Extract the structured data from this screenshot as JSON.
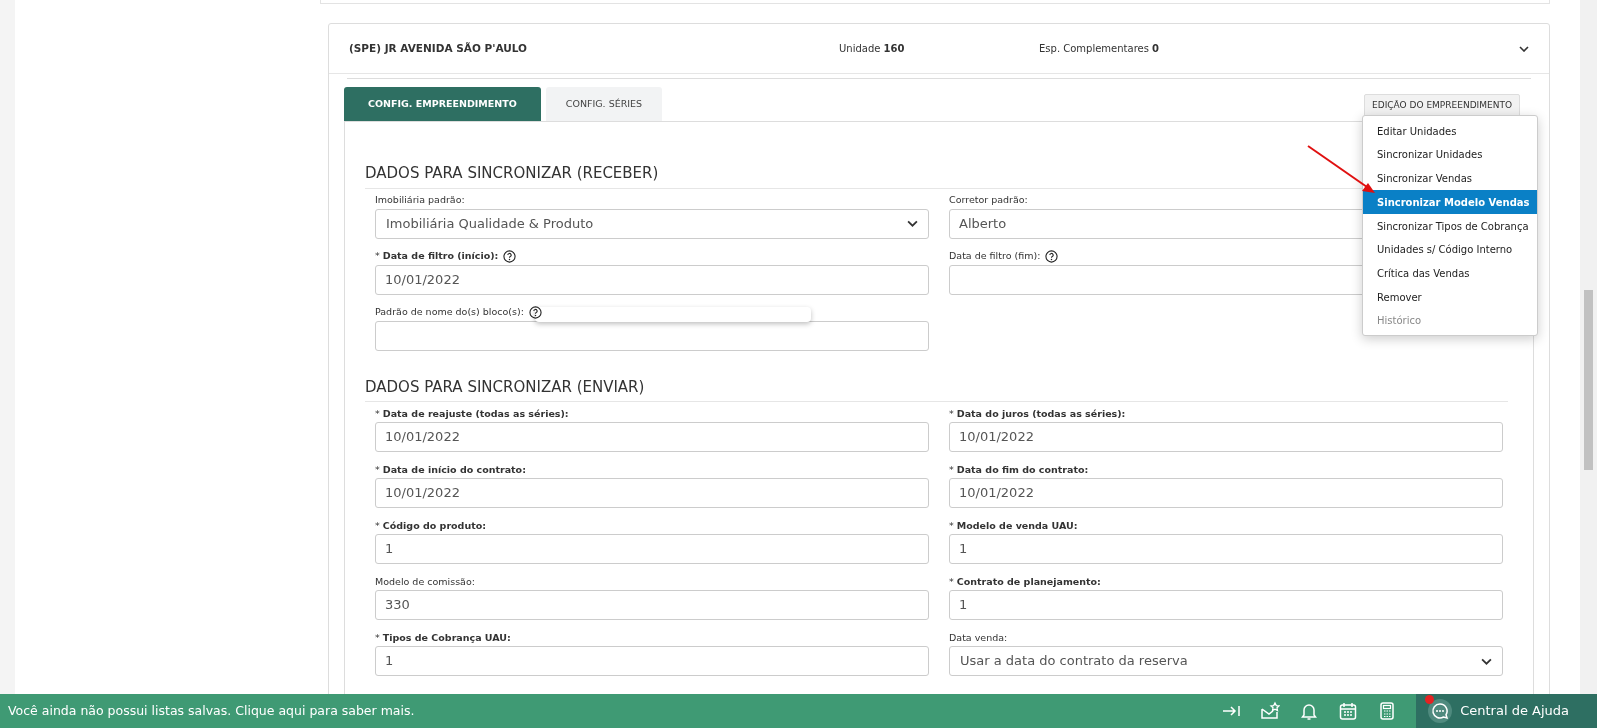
{
  "card": {
    "title": "(SPE) JR AVENIDA SÃO P'AULO",
    "units_label": "Unidade",
    "units_value": "160",
    "extra_label": "Esp. Complementares",
    "extra_value": "0",
    "expanded": true
  },
  "tabs": [
    {
      "label": "CONFIG. EMPREENDIMENTO",
      "selected": true
    },
    {
      "label": "CONFIG. SÉRIES",
      "selected": false
    }
  ],
  "edit_button": {
    "label": "EDIÇÃO DO EMPREENDIMENTO",
    "open": true
  },
  "edit_menu": [
    {
      "label": "Editar Unidades",
      "selected": false,
      "disabled": false
    },
    {
      "label": "Sincronizar Unidades",
      "selected": false,
      "disabled": false
    },
    {
      "label": "Sincronizar Vendas",
      "selected": false,
      "disabled": false
    },
    {
      "label": "Sincronizar Modelo Vendas",
      "selected": true,
      "disabled": false
    },
    {
      "label": "Sincronizar Tipos de Cobrança",
      "selected": false,
      "disabled": false
    },
    {
      "label": "Unidades s/ Código Interno",
      "selected": false,
      "disabled": false
    },
    {
      "label": "Crítica das Vendas",
      "selected": false,
      "disabled": false
    },
    {
      "label": "Remover",
      "selected": false,
      "disabled": false
    },
    {
      "label": "Histórico",
      "selected": false,
      "disabled": true
    }
  ],
  "sections": [
    {
      "heading": "DADOS PARA SINCRONIZAR (RECEBER)",
      "rows": [
        [
          {
            "label": "Imobiliária padrão:",
            "kind": "select",
            "value": "Imobiliária Qualidade & Produto",
            "help": false,
            "tooltip": false
          },
          {
            "label": "Corretor padrão:",
            "kind": "input",
            "value": "Alberto",
            "help": false,
            "tooltip": false
          }
        ],
        [
          {
            "label": "* **Data de filtro (início):**",
            "kind": "input",
            "value": "10/01/2022",
            "help": true,
            "tooltip": false
          },
          {
            "label": "Data de filtro (fim):",
            "kind": "input",
            "help": true,
            "tooltip": false
          }
        ],
        [
          {
            "label": "Padrão de nome do(s) bloco(s):",
            "kind": "input",
            "help": true,
            "tooltip": true
          }
        ]
      ]
    },
    {
      "heading": "DADOS PARA SINCRONIZAR (ENVIAR)",
      "rows": [
        [
          {
            "label": "* **Data de reajuste (todas as séries):**",
            "kind": "input",
            "value": "10/01/2022",
            "help": false,
            "tooltip": false
          },
          {
            "label": "* **Data do juros (todas as séries):**",
            "kind": "input",
            "value": "10/01/2022",
            "help": false,
            "tooltip": false
          }
        ],
        [
          {
            "label": "* **Data de início do contrato:**",
            "kind": "input",
            "value": "10/01/2022",
            "help": false,
            "tooltip": false
          },
          {
            "label": "* **Data do fim do contrato:**",
            "kind": "input",
            "value": "10/01/2022",
            "help": false,
            "tooltip": false
          }
        ],
        [
          {
            "label": "* **Código do produto:**",
            "kind": "input",
            "value": "1",
            "help": false,
            "tooltip": false
          },
          {
            "label": "* **Modelo de venda UAU:**",
            "kind": "input",
            "value": "1",
            "help": false,
            "tooltip": false
          }
        ],
        [
          {
            "label": "Modelo de comissão:",
            "kind": "input",
            "value": "330",
            "help": false,
            "tooltip": false
          },
          {
            "label": "* **Contrato de planejamento:**",
            "kind": "input",
            "value": "1",
            "help": false,
            "tooltip": false
          }
        ],
        [
          {
            "label": "* **Tipos de Cobrança UAU:**",
            "kind": "input",
            "value": "1",
            "help": false,
            "tooltip": false
          },
          {
            "label": "Data venda:",
            "kind": "select",
            "value": "Usar a data do contrato da reserva",
            "help": false,
            "tooltip": false
          }
        ]
      ]
    }
  ],
  "footer": {
    "message": "Você ainda não possui listas salvas. Clique aqui para saber mais.",
    "tools": [
      {
        "kind": "collapse"
      },
      {
        "kind": "mail"
      },
      {
        "kind": "bell"
      },
      {
        "kind": "calendar"
      },
      {
        "kind": "calculator"
      }
    ],
    "help_label": "Central de Ajuda",
    "help_notification": true
  }
}
